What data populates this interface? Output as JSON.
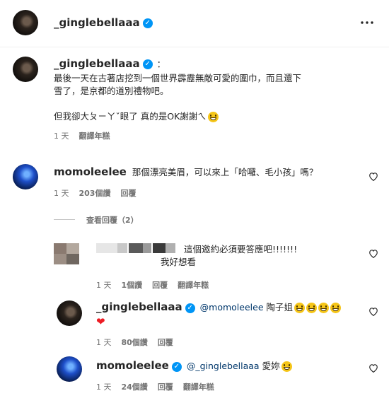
{
  "header": {
    "username": "_ginglebellaaa",
    "more_icon": "more-horizontal-icon"
  },
  "caption": {
    "username": "_ginglebellaaa",
    "separator": "：",
    "line1": "最後一天在古著店挖到一個世界霹靂無敵可愛的圍巾，而且還下",
    "line2": "雪了，是京都的道別禮物吧。",
    "line3": "但我卻大ㄆㄧㄚˇ眼了 真的是OK謝謝ㄟ",
    "time": "1 天",
    "translate": "翻譯年糕"
  },
  "comments": [
    {
      "username": "momoleelee",
      "text": "那個漂亮美眉，可以來上「哈囉、毛小孩」嗎？",
      "time": "1 天",
      "likes": "203個讚",
      "reply": "回覆"
    }
  ],
  "view_replies": "查看回覆（2）",
  "replies": [
    {
      "text1": "這個邀約必須要答應吧!!!!!!!",
      "text2": "我好想看",
      "time": "1 天",
      "likes": "1個讚",
      "reply": "回覆",
      "translate": "翻譯年糕"
    },
    {
      "username": "_ginglebellaaa",
      "mention": "@momoleelee",
      "text": "陶子姐",
      "time": "1 天",
      "likes": "80個讚",
      "reply": "回覆"
    },
    {
      "username": "momoleelee",
      "mention": "@_ginglebellaaa",
      "text": "愛妳",
      "time": "1 天",
      "likes": "24個讚",
      "reply": "回覆",
      "translate": "翻譯年糕"
    }
  ],
  "colors": {
    "verified": "#0095f6",
    "meta": "#737373",
    "mention": "#00376b"
  }
}
